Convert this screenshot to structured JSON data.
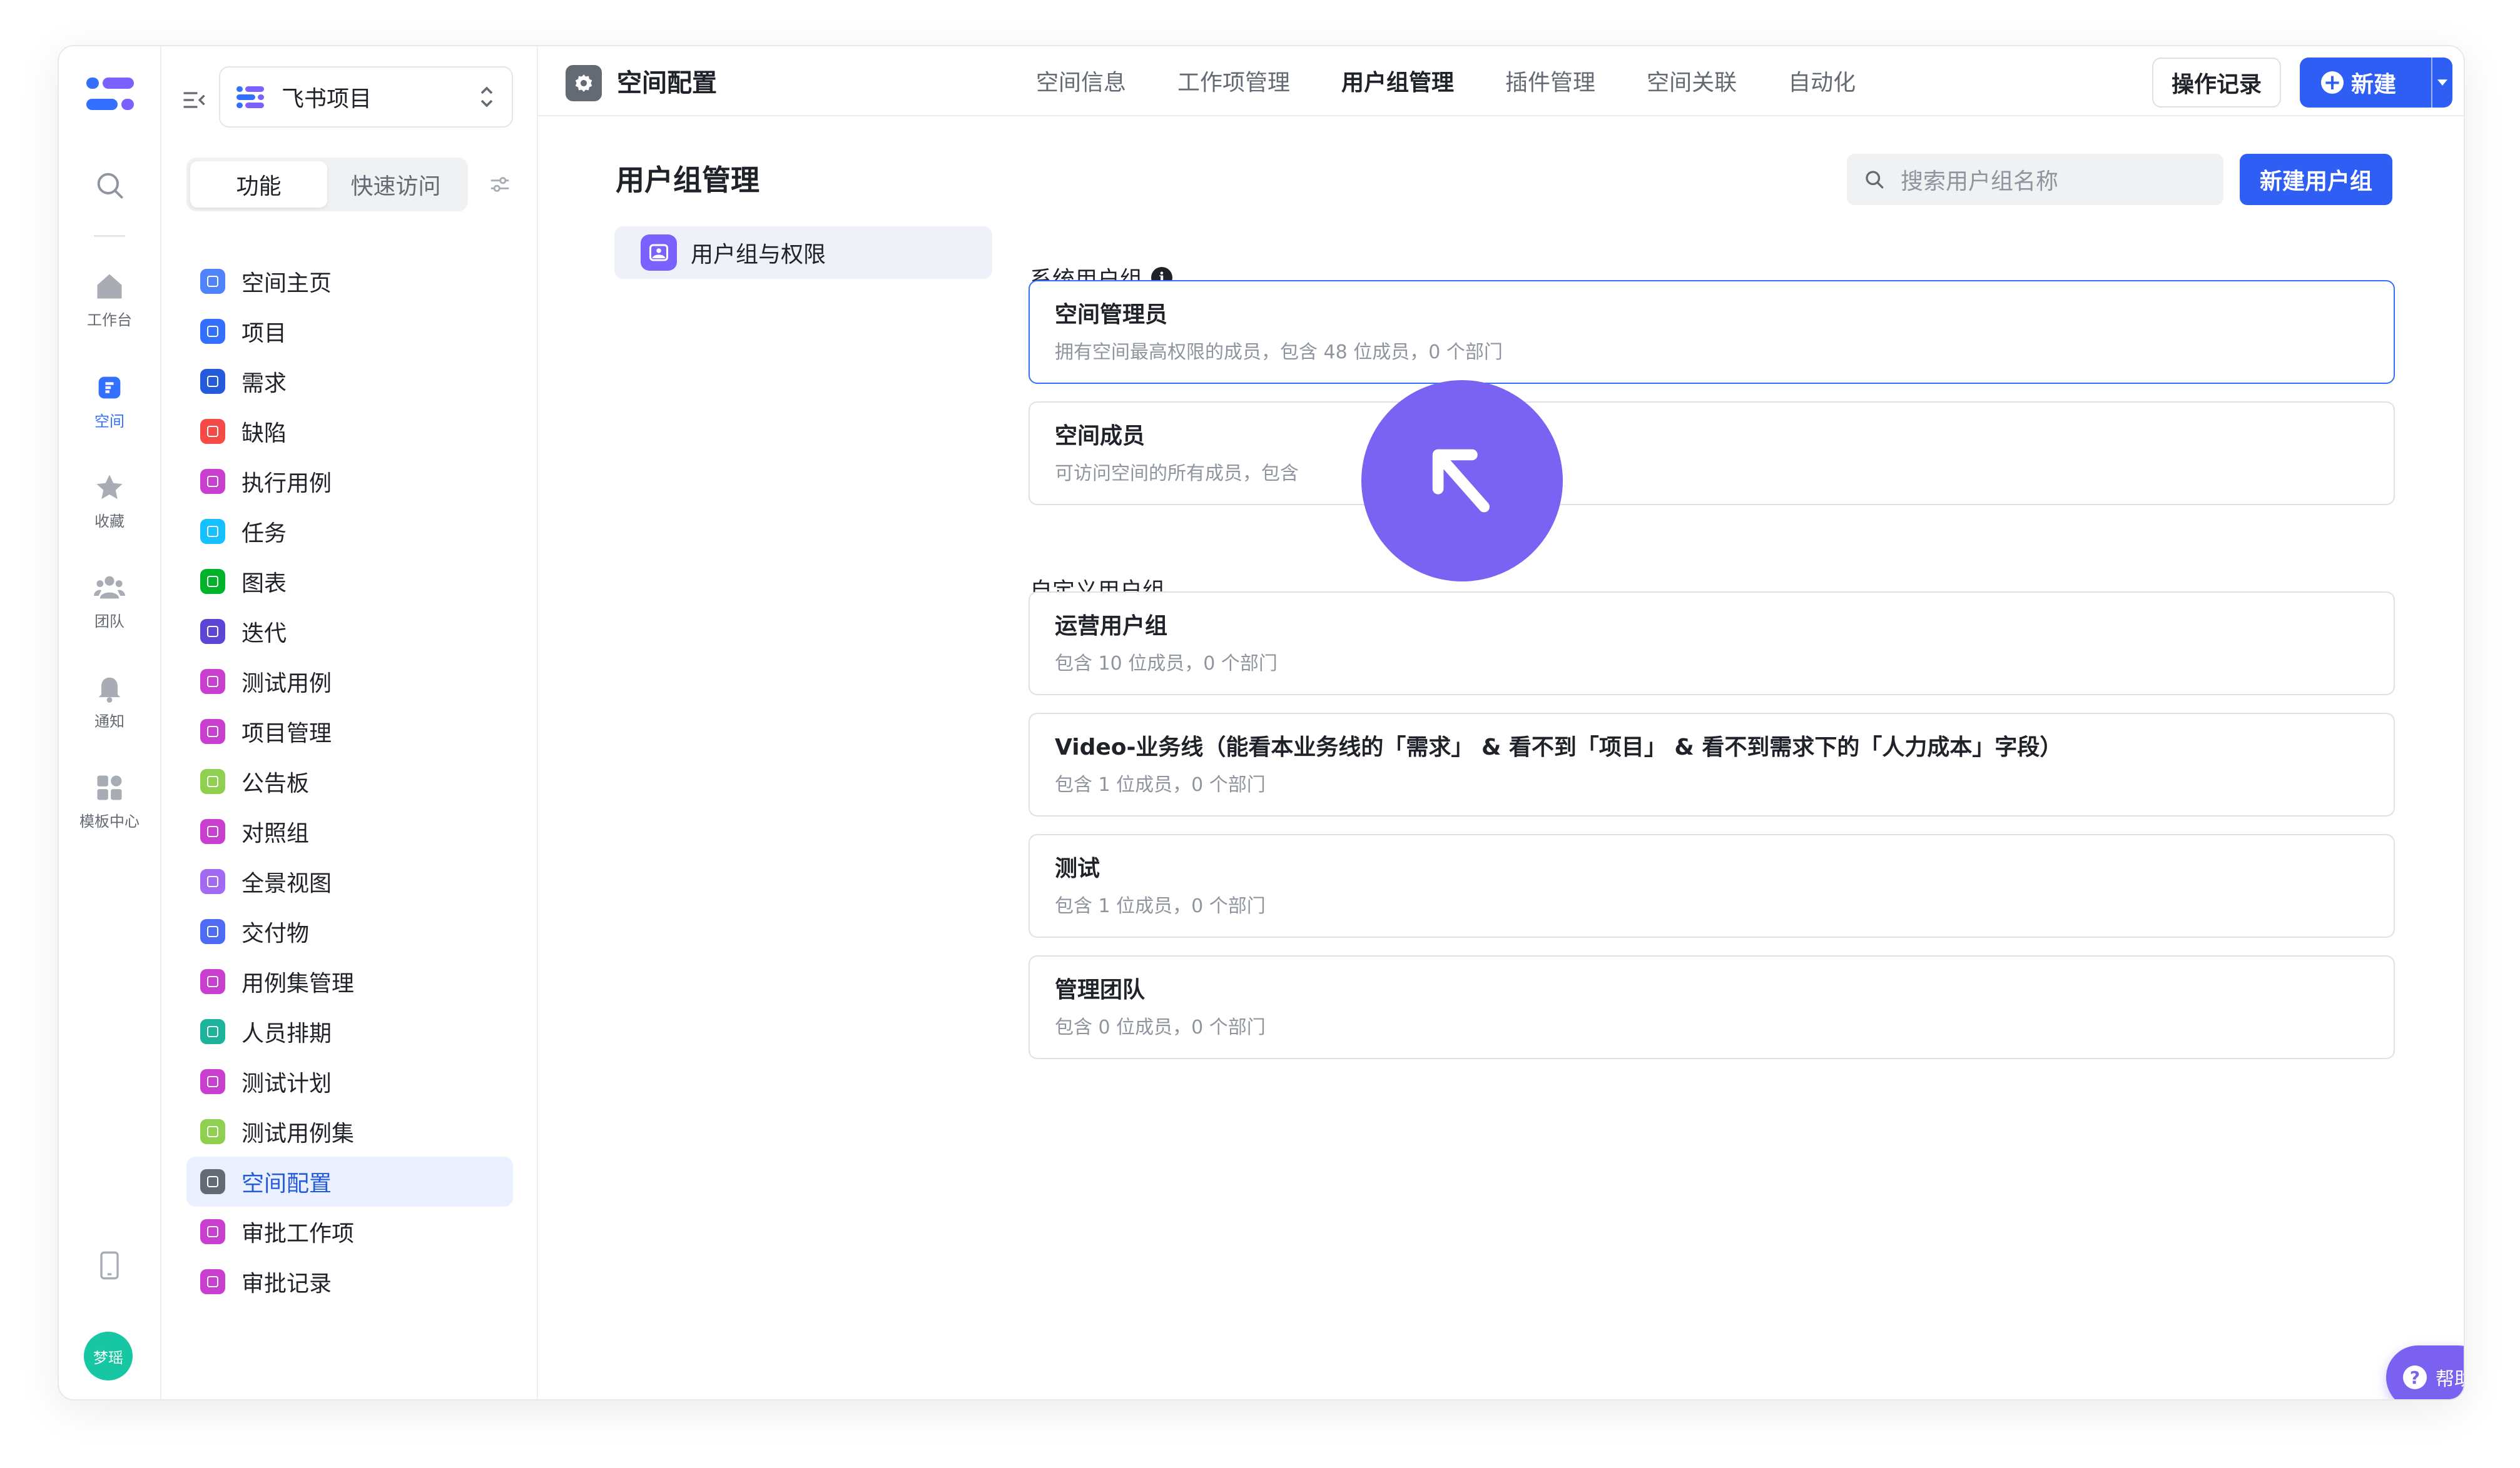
{
  "rail": {
    "items": [
      {
        "label": "工作台"
      },
      {
        "label": "空间"
      },
      {
        "label": "收藏"
      },
      {
        "label": "团队"
      },
      {
        "label": "通知"
      },
      {
        "label": "模板中心"
      }
    ],
    "avatar_text": "梦瑶"
  },
  "sidebar": {
    "space_name": "飞书项目",
    "segments": [
      "功能",
      "快速访问"
    ],
    "items": [
      {
        "label": "空间主页",
        "color": "#4e83fd"
      },
      {
        "label": "项目",
        "color": "#3370ff"
      },
      {
        "label": "需求",
        "color": "#245bdb"
      },
      {
        "label": "缺陷",
        "color": "#f54a45"
      },
      {
        "label": "执行用例",
        "color": "#c93ece"
      },
      {
        "label": "任务",
        "color": "#14c0ff"
      },
      {
        "label": "图表",
        "color": "#00b42a"
      },
      {
        "label": "迭代",
        "color": "#5b46d6"
      },
      {
        "label": "测试用例",
        "color": "#c93ece"
      },
      {
        "label": "项目管理",
        "color": "#c93ece"
      },
      {
        "label": "公告板",
        "color": "#8fd14f"
      },
      {
        "label": "对照组",
        "color": "#c93ece"
      },
      {
        "label": "全景视图",
        "color": "#a26af3"
      },
      {
        "label": "交付物",
        "color": "#4e6bf5"
      },
      {
        "label": "用例集管理",
        "color": "#c93ece"
      },
      {
        "label": "人员排期",
        "color": "#1db39b"
      },
      {
        "label": "测试计划",
        "color": "#c93ece"
      },
      {
        "label": "测试用例集",
        "color": "#8fd14f"
      },
      {
        "label": "空间配置",
        "color": "#646a73"
      },
      {
        "label": "审批工作项",
        "color": "#c93ece"
      },
      {
        "label": "审批记录",
        "color": "#c93ece"
      }
    ],
    "active_index": 18
  },
  "header": {
    "title": "空间配置",
    "tabs": [
      "空间信息",
      "工作项管理",
      "用户组管理",
      "插件管理",
      "空间关联",
      "自动化"
    ],
    "active_tab": 2,
    "log_label": "操作记录",
    "new_label": "新建"
  },
  "main": {
    "title": "用户组管理",
    "search_placeholder": "搜索用户组名称",
    "create_label": "新建用户组",
    "nav_label": "用户组与权限",
    "system_label": "系统用户组",
    "custom_label": "自定义用户组",
    "system_groups": [
      {
        "name": "空间管理员",
        "desc": "拥有空间最高权限的成员，包含 48 位成员，0 个部门"
      },
      {
        "name": "空间成员",
        "desc": "可访问空间的所有成员，包含"
      }
    ],
    "custom_groups": [
      {
        "name": "运营用户组",
        "desc": "包含 10 位成员，0 个部门"
      },
      {
        "name": "Video-业务线（能看本业务线的「需求」 & 看不到「项目」 & 看不到需求下的「人力成本」字段）",
        "desc": "包含 1 位成员，0 个部门"
      },
      {
        "name": "测试",
        "desc": "包含 1 位成员，0 个部门"
      },
      {
        "name": "管理团队",
        "desc": "包含 0 位成员，0 个部门"
      }
    ]
  },
  "help_label": "帮助"
}
